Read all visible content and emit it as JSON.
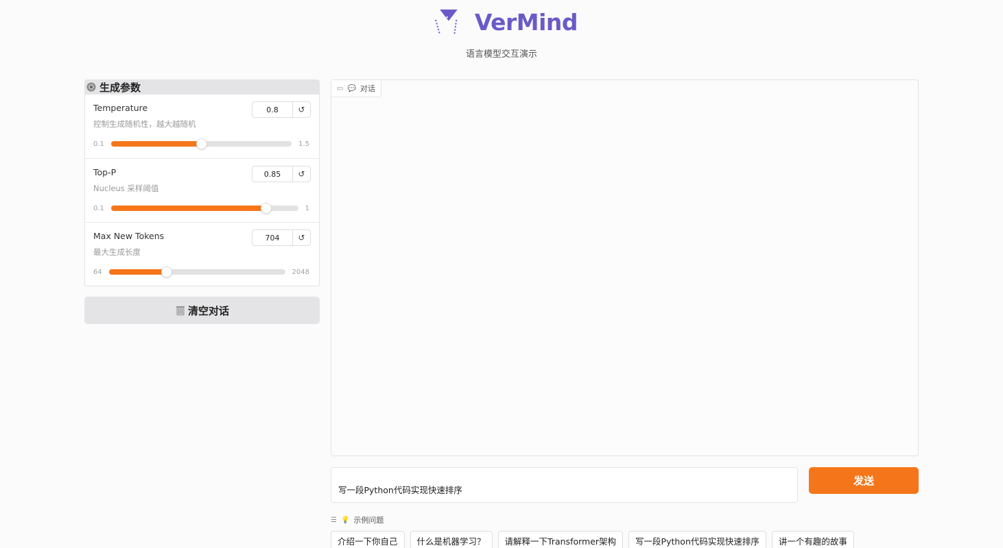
{
  "header": {
    "brand": "VerMind",
    "subtitle": "语言模型交互演示",
    "brand_color": "#6a5ac8"
  },
  "params": {
    "title": "生成参数",
    "title_icon": "gear-icon",
    "items": [
      {
        "label": "Temperature",
        "desc": "控制生成随机性，越大越随机",
        "value": "0.8",
        "min": "0.1",
        "max": "1.5",
        "fraction": 0.5
      },
      {
        "label": "Top-P",
        "desc": "Nucleus 采样阈值",
        "value": "0.85",
        "min": "0.1",
        "max": "1",
        "fraction": 0.83
      },
      {
        "label": "Max New Tokens",
        "desc": "最大生成长度",
        "value": "704",
        "min": "64",
        "max": "2048",
        "fraction": 0.33
      }
    ],
    "accent": "#f5761a"
  },
  "clear_button": {
    "label": "清空对话",
    "icon": "trash-icon"
  },
  "chat": {
    "tag": "对话",
    "icon": "chat-icon"
  },
  "input": {
    "value": "写一段Python代码实现快速排序"
  },
  "send_button": {
    "label": "发送"
  },
  "examples": {
    "label": "示例问题",
    "icon": "lightbulb-icon",
    "items": [
      "介绍一下你自己",
      "什么是机器学习？",
      "请解释一下Transformer架构",
      "写一段Python代码实现快速排序",
      "讲一个有趣的故事"
    ]
  }
}
